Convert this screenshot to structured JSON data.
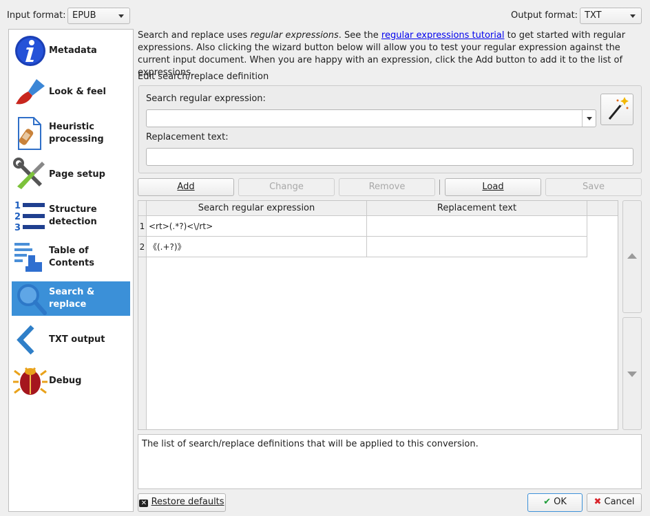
{
  "header": {
    "input_format_label": "Input format:",
    "input_format_value": "EPUB",
    "output_format_label": "Output format:",
    "output_format_value": "TXT"
  },
  "sidebar": {
    "items": [
      {
        "label": "Metadata",
        "icon": "info-icon"
      },
      {
        "label": "Look & feel",
        "icon": "paintbrush-icon"
      },
      {
        "label": "Heuristic processing",
        "icon": "document-bandage-icon"
      },
      {
        "label": "Page setup",
        "icon": "wrench-screwdriver-icon"
      },
      {
        "label": "Structure detection",
        "icon": "numbered-list-icon"
      },
      {
        "label": "Table of Contents",
        "icon": "toc-pointer-icon"
      },
      {
        "label": "Search & replace",
        "icon": "magnifier-icon",
        "active": true
      },
      {
        "label": "TXT output",
        "icon": "chevron-left-icon"
      },
      {
        "label": "Debug",
        "icon": "bug-icon"
      }
    ],
    "active_color": "#3b90d8"
  },
  "description": {
    "part1": "Search and replace uses ",
    "italic": "regular expressions",
    "part2": ". See the ",
    "link": "regular expressions tutorial",
    "part3": " to get started with regular expressions. Also clicking the wizard button below will allow you to test your regular expression against the current input document. When you are happy with an expression, click the Add button to add it to the list of expressions."
  },
  "edit_section": {
    "title": "Edit search/replace definition",
    "search_label": "Search regular expression:",
    "search_value": "",
    "replace_label": "Replacement text:",
    "replace_value": ""
  },
  "buttons": {
    "add": "Add",
    "change": "Change",
    "remove": "Remove",
    "load": "Load",
    "save": "Save",
    "restore_defaults": "Restore defaults",
    "ok": "OK",
    "cancel": "Cancel"
  },
  "table": {
    "columns": [
      "Search regular expression",
      "Replacement text"
    ],
    "rows": [
      {
        "num": "1",
        "search": "<rt>(.*?)<\\/rt>",
        "replace": ""
      },
      {
        "num": "2",
        "search": "《(.+?)》",
        "replace": ""
      }
    ]
  },
  "help_text": "The list of search/replace definitions that will be applied to this conversion.",
  "colors": {
    "link": "#0000ee",
    "ok_check": "#1f9d3a",
    "cancel_x": "#d8232a"
  }
}
